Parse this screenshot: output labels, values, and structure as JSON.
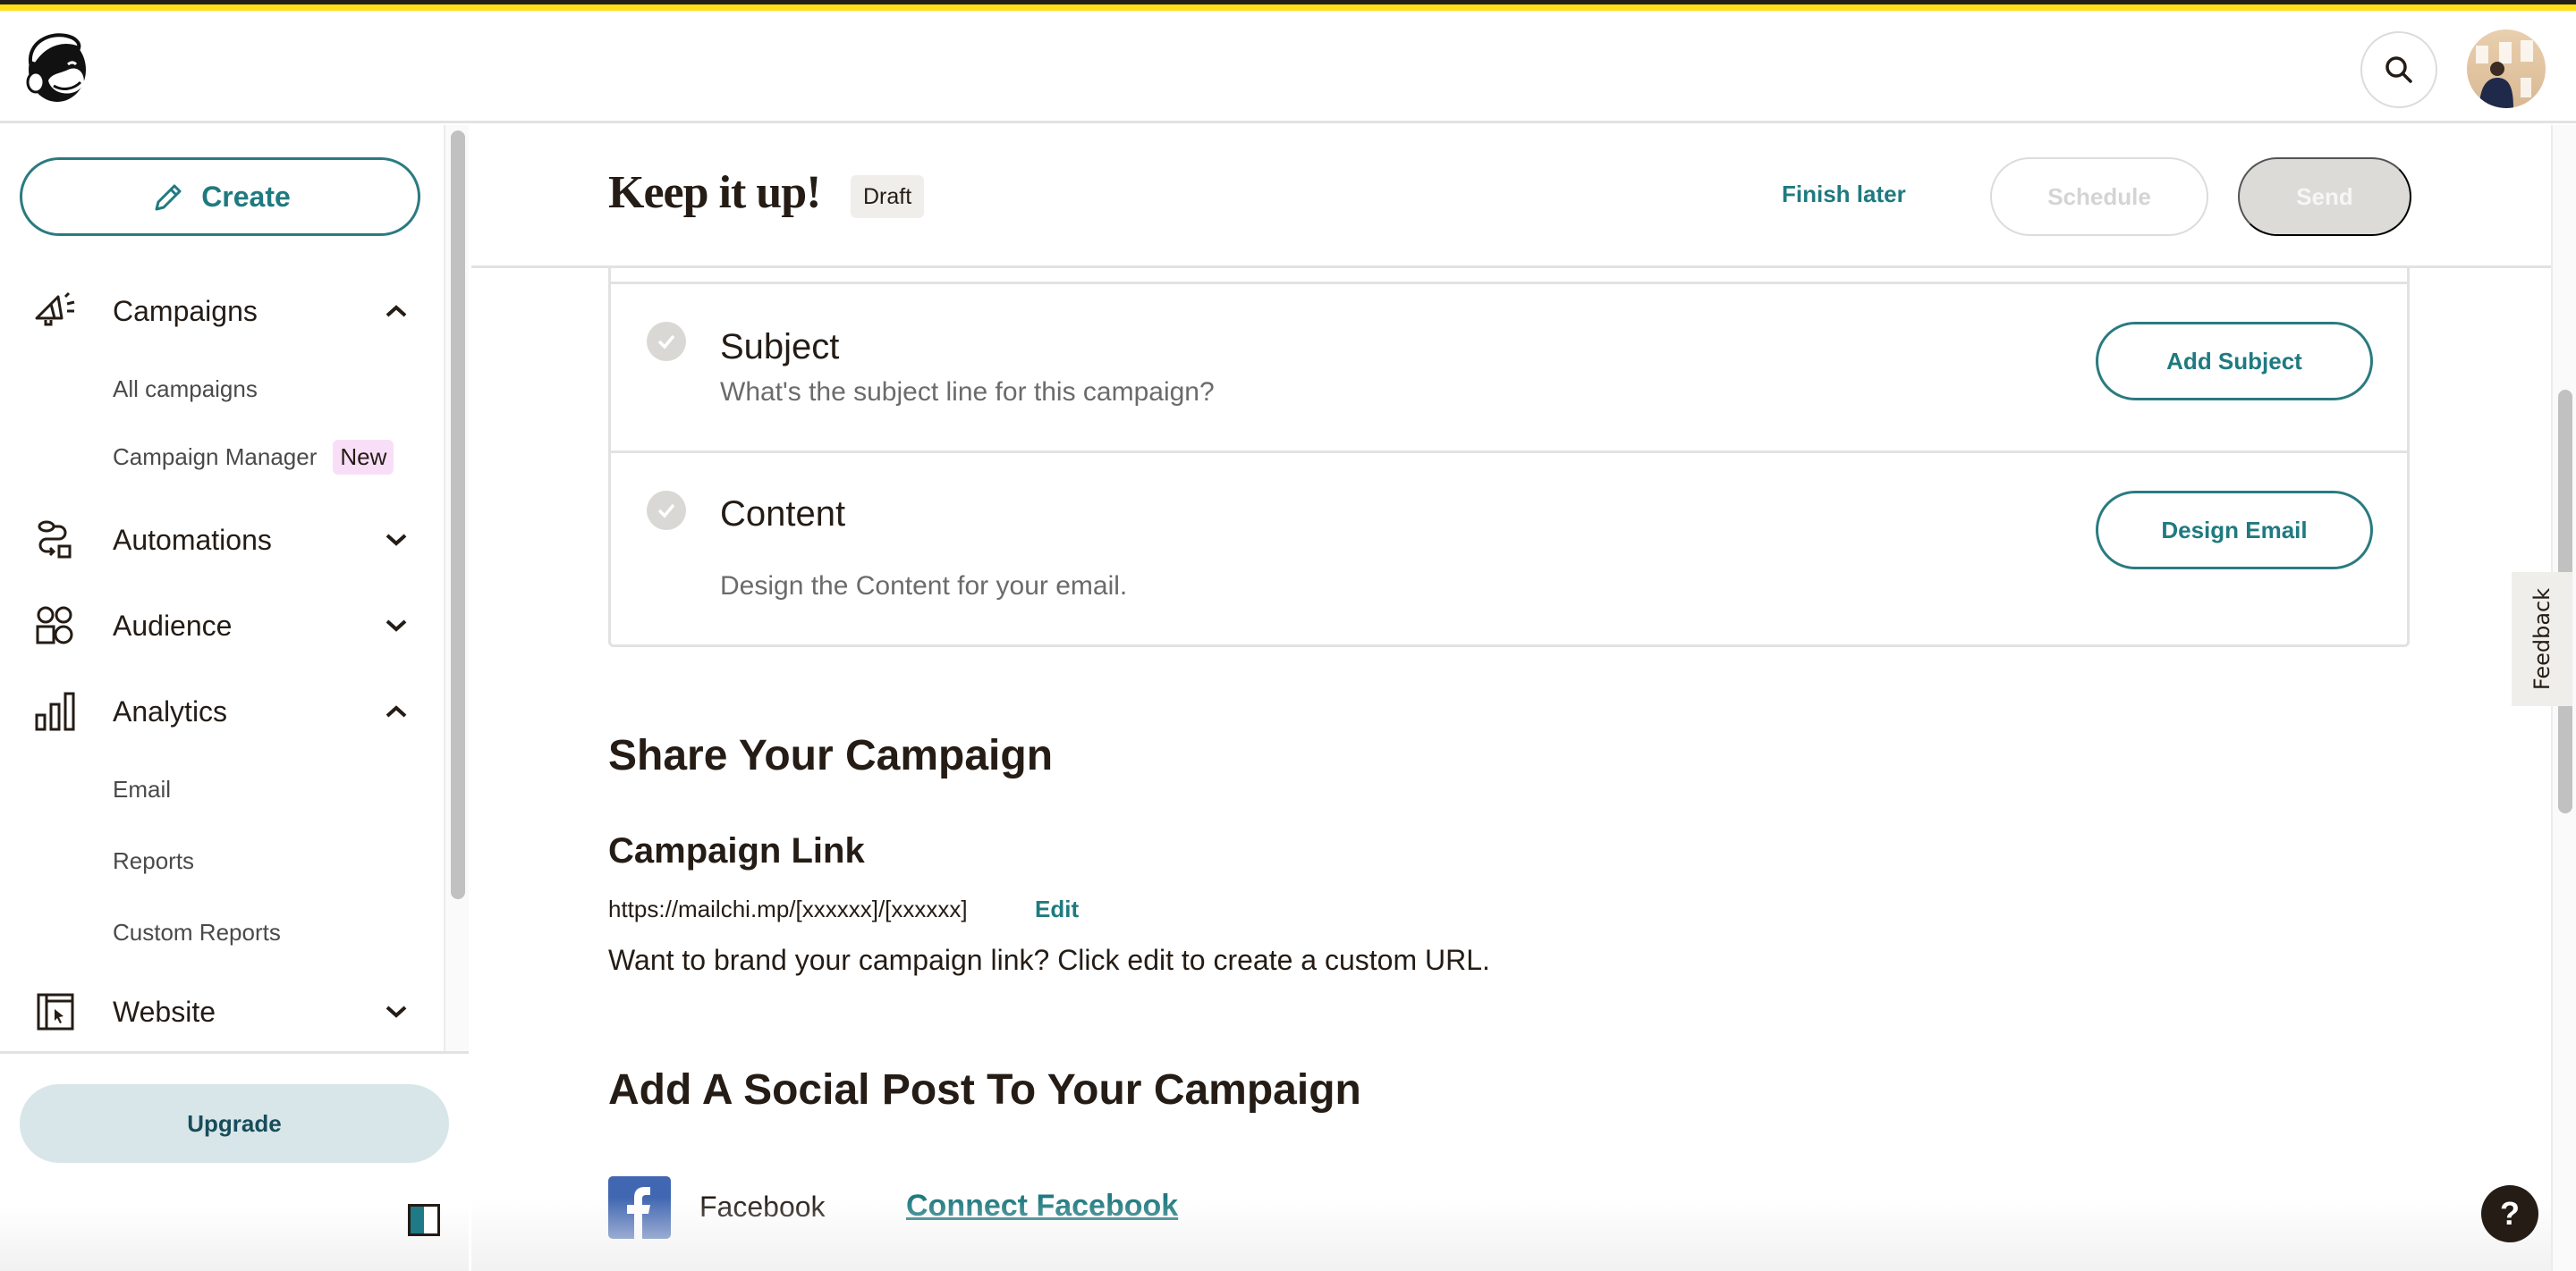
{
  "app": {
    "brand": "Mailchimp",
    "accent_color": "#1f7a80",
    "top_bar_color": "#ffe01b"
  },
  "header": {
    "search_icon": "search-icon",
    "avatar_icon": "user-avatar"
  },
  "sidebar": {
    "create_label": "Create",
    "sections": [
      {
        "label": "Campaigns",
        "icon": "megaphone-icon",
        "expanded": true,
        "items": [
          {
            "label": "All campaigns"
          },
          {
            "label": "Campaign Manager",
            "badge": "New"
          }
        ]
      },
      {
        "label": "Automations",
        "icon": "automation-flow-icon",
        "expanded": false
      },
      {
        "label": "Audience",
        "icon": "audience-icon",
        "expanded": false
      },
      {
        "label": "Analytics",
        "icon": "bar-chart-icon",
        "expanded": true,
        "items": [
          {
            "label": "Email"
          },
          {
            "label": "Reports"
          },
          {
            "label": "Custom Reports"
          }
        ]
      },
      {
        "label": "Website",
        "icon": "website-cursor-icon",
        "expanded": false
      }
    ],
    "upgrade_label": "Upgrade"
  },
  "main": {
    "title": "Keep it up!",
    "status_badge": "Draft",
    "finish_later_label": "Finish later",
    "schedule_label": "Schedule",
    "send_label": "Send",
    "checklist": [
      {
        "title": "Subject",
        "description": "What's the subject line for this campaign?",
        "action": "Add Subject"
      },
      {
        "title": "Content",
        "description": "Design the Content for your email.",
        "action": "Design Email"
      }
    ],
    "share": {
      "heading": "Share Your Campaign",
      "link_heading": "Campaign Link",
      "link_url": "https://mailchi.mp/[xxxxxx]/[xxxxxx]",
      "edit_label": "Edit",
      "hint": "Want to brand your campaign link? Click edit to create a custom URL."
    },
    "social": {
      "heading": "Add A Social Post To Your Campaign",
      "networks": [
        {
          "name": "Facebook",
          "connect_label": "Connect Facebook",
          "color": "#4267b2"
        }
      ]
    }
  },
  "feedback_label": "Feedback",
  "help_label": "?"
}
